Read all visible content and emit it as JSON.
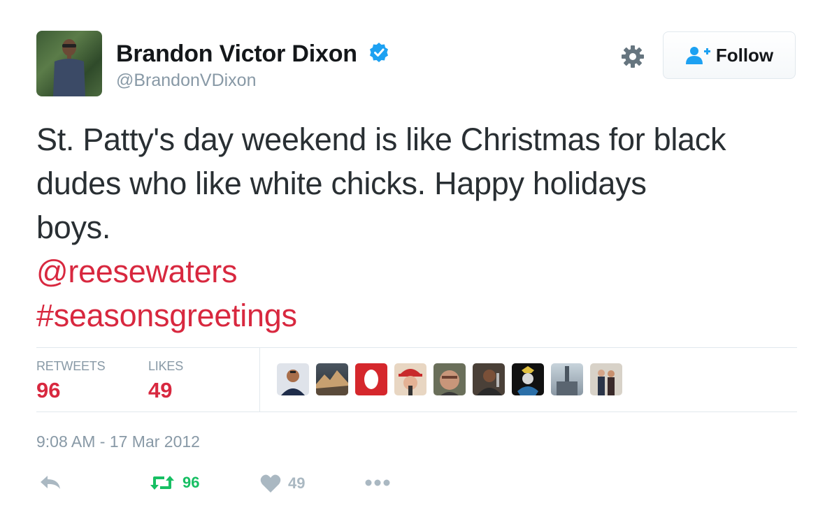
{
  "user": {
    "name": "Brandon Victor Dixon",
    "screen_name": "@BrandonVDixon",
    "verified": true
  },
  "follow_button": {
    "label": "Follow"
  },
  "tweet": {
    "lines": [
      "St. Patty's day weekend is like Christmas for black",
      "dudes who like white chicks. Happy holidays",
      "boys."
    ],
    "mention": "@reesewaters",
    "hashtag": "#seasonsgreetings"
  },
  "stats": {
    "retweets_label": "RETWEETS",
    "retweets_value": "96",
    "likes_label": "LIKES",
    "likes_value": "49"
  },
  "timestamp": "9:08 AM - 17 Mar 2012",
  "actions": {
    "retweet_count": "96",
    "like_count": "49"
  },
  "colors": {
    "link": "#d8283f",
    "muted": "#8899a6",
    "verified": "#1da1f2",
    "retweet_active": "#17bf63"
  },
  "icons": [
    "gear-icon",
    "verified-badge-icon",
    "follow-person-plus-icon",
    "reply-icon",
    "retweet-icon",
    "heart-icon",
    "more-dots-icon"
  ]
}
